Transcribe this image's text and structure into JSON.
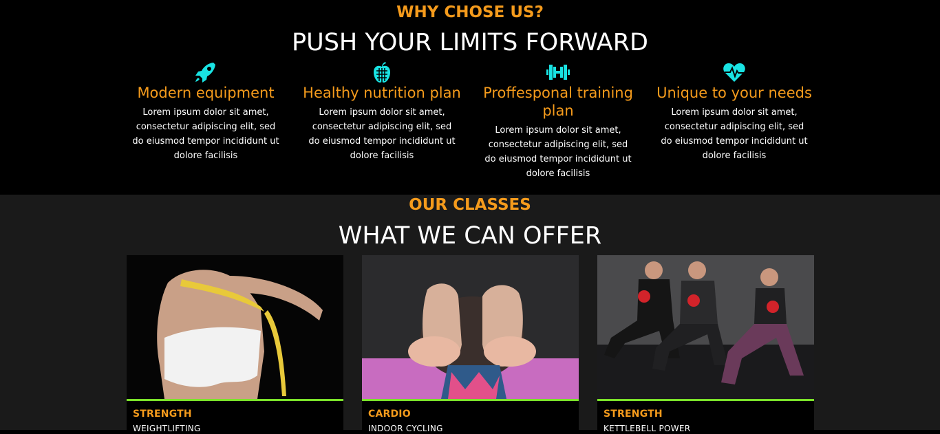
{
  "why": {
    "eyebrow": "WHY CHOSE US?",
    "title": "PUSH YOUR LIMITS FORWARD",
    "features": [
      {
        "icon": "rocket-icon",
        "title": "Modern equipment",
        "text": "Lorem ipsum dolor sit amet, consectetur adipiscing elit, sed do eiusmod tempor incididunt ut dolore facilisis"
      },
      {
        "icon": "apple-icon",
        "title": "Healthy nutrition plan",
        "text": "Lorem ipsum dolor sit amet, consectetur adipiscing elit, sed do eiusmod tempor incididunt ut dolore facilisis"
      },
      {
        "icon": "dumbbell-icon",
        "title": "Proffesponal training plan",
        "text": "Lorem ipsum dolor sit amet, consectetur adipiscing elit, sed do eiusmod tempor incididunt ut dolore facilisis"
      },
      {
        "icon": "heartbeat-icon",
        "title": "Unique to your needs",
        "text": "Lorem ipsum dolor sit amet, consectetur adipiscing elit, sed do eiusmod tempor incididunt ut dolore facilisis"
      }
    ]
  },
  "classes": {
    "eyebrow": "OUR CLASSES",
    "title": "WHAT WE CAN OFFER",
    "cards": [
      {
        "category": "STRENGTH",
        "name": "WEIGHTLIFTING"
      },
      {
        "category": "CARDIO",
        "name": "INDOOR CYCLING"
      },
      {
        "category": "STRENGTH",
        "name": "KETTLEBELL POWER"
      }
    ]
  },
  "colors": {
    "accent": "#f59b1c",
    "icon": "#19e3e3",
    "bar": "#7be22a",
    "dark_bg": "#000000",
    "section_bg": "#1a1a1a"
  }
}
